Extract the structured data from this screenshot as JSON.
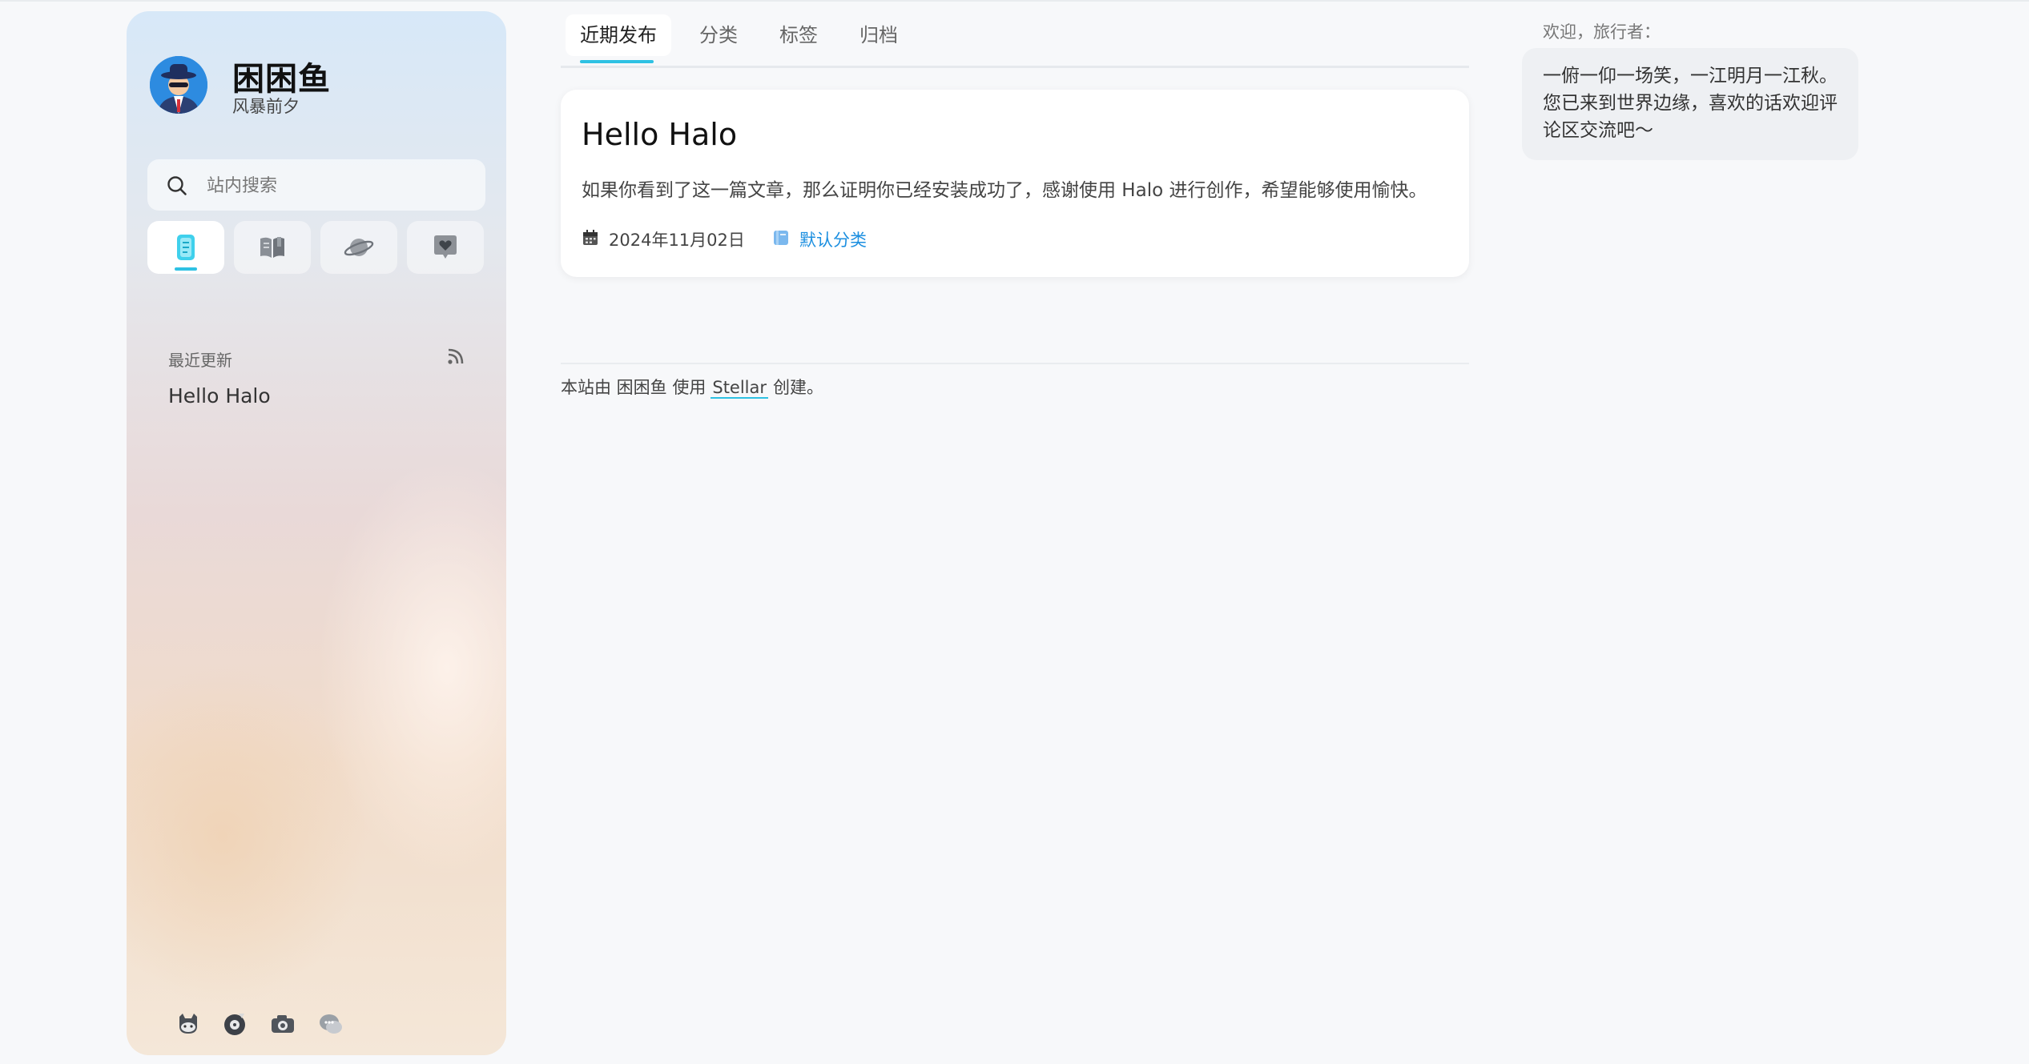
{
  "site": {
    "title": "困困鱼",
    "subtitle": "风暴前夕"
  },
  "sidebar": {
    "search_placeholder": "站内搜索",
    "nav": [
      {
        "icon": "document-icon",
        "active": true
      },
      {
        "icon": "book-icon",
        "active": false
      },
      {
        "icon": "planet-icon",
        "active": false
      },
      {
        "icon": "heart-chat-icon",
        "active": false
      }
    ],
    "recent": {
      "title": "最近更新",
      "items": [
        "Hello Halo"
      ]
    },
    "social": [
      "github-icon",
      "music-icon",
      "camera-icon",
      "chat-icon"
    ]
  },
  "tabs": [
    {
      "label": "近期发布",
      "active": true
    },
    {
      "label": "分类",
      "active": false
    },
    {
      "label": "标签",
      "active": false
    },
    {
      "label": "归档",
      "active": false
    }
  ],
  "posts": [
    {
      "title": "Hello Halo",
      "excerpt": "如果你看到了这一篇文章，那么证明你已经安装成功了，感谢使用 Halo 进行创作，希望能够使用愉快。",
      "date": "2024年11月02日",
      "category": "默认分类"
    }
  ],
  "footer": {
    "prefix": "本站由 困困鱼 使用",
    "link": "Stellar",
    "suffix": "创建。"
  },
  "welcome": {
    "label": "欢迎，旅行者：",
    "text": "一俯一仰一场笑，一江明月一江秋。您已来到世界边缘，喜欢的话欢迎评论区交流吧～"
  },
  "colors": {
    "accent": "#2ec1e3",
    "link": "#1c8fe0",
    "background": "#f7f8fa"
  }
}
